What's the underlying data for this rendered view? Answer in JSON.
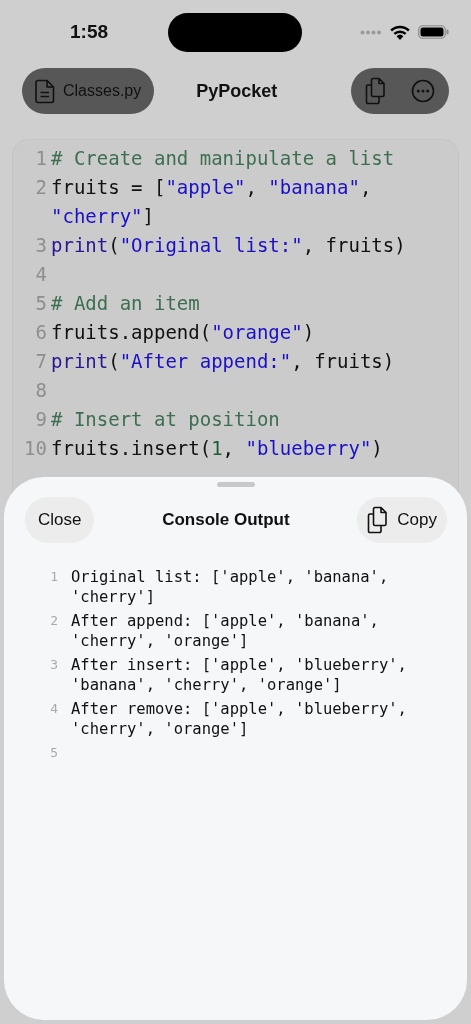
{
  "status_bar": {
    "time": "1:58"
  },
  "toolbar": {
    "file_button": "Classes.py",
    "title": "PyPocket"
  },
  "editor": {
    "lines": [
      {
        "number": "1",
        "tokens": [
          {
            "kind": "comment",
            "text": "# Create and manipulate a list"
          }
        ]
      },
      {
        "number": "2",
        "tokens": [
          {
            "kind": "plain",
            "text": "fruits = ["
          },
          {
            "kind": "string",
            "text": "\"apple\""
          },
          {
            "kind": "plain",
            "text": ", "
          },
          {
            "kind": "string",
            "text": "\"banana\""
          },
          {
            "kind": "plain",
            "text": ", "
          },
          {
            "kind": "string",
            "text": "\"cherry\""
          },
          {
            "kind": "plain",
            "text": "]"
          }
        ]
      },
      {
        "number": "3",
        "tokens": [
          {
            "kind": "builtin",
            "text": "print"
          },
          {
            "kind": "plain",
            "text": "("
          },
          {
            "kind": "string",
            "text": "\"Original list:\""
          },
          {
            "kind": "plain",
            "text": ", fruits)"
          }
        ]
      },
      {
        "number": "4"
      },
      {
        "number": "5",
        "tokens": [
          {
            "kind": "comment",
            "text": "# Add an item"
          }
        ]
      },
      {
        "number": "6",
        "tokens": [
          {
            "kind": "plain",
            "text": "fruits.append("
          },
          {
            "kind": "string",
            "text": "\"orange\""
          },
          {
            "kind": "plain",
            "text": ")"
          }
        ]
      },
      {
        "number": "7",
        "tokens": [
          {
            "kind": "builtin",
            "text": "print"
          },
          {
            "kind": "plain",
            "text": "("
          },
          {
            "kind": "string",
            "text": "\"After append:\""
          },
          {
            "kind": "plain",
            "text": ", fruits)"
          }
        ]
      },
      {
        "number": "8"
      },
      {
        "number": "9",
        "tokens": [
          {
            "kind": "comment",
            "text": "# Insert at position"
          }
        ]
      },
      {
        "number": "10",
        "tokens": [
          {
            "kind": "plain",
            "text": "fruits.insert("
          },
          {
            "kind": "number",
            "text": "1"
          },
          {
            "kind": "plain",
            "text": ", "
          },
          {
            "kind": "string",
            "text": "\"blueberry\""
          },
          {
            "kind": "plain",
            "text": ")"
          }
        ]
      }
    ]
  },
  "sheet": {
    "close_button": "Close",
    "title": "Console Output",
    "copy_button": "Copy",
    "lines": [
      {
        "number": "1",
        "text": "Original list: ['apple', 'banana', 'cherry']"
      },
      {
        "number": "2",
        "text": "After append: ['apple', 'banana', 'cherry', 'orange']"
      },
      {
        "number": "3",
        "text": "After insert: ['apple', 'blueberry', 'banana', 'cherry', 'orange']"
      },
      {
        "number": "4",
        "text": "After remove: ['apple', 'blueberry', 'cherry', 'orange']"
      },
      {
        "number": "5"
      }
    ]
  }
}
